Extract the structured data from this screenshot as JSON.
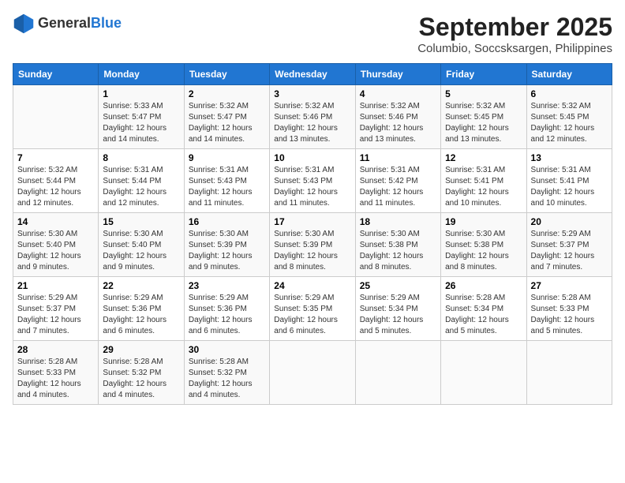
{
  "header": {
    "logo_general": "General",
    "logo_blue": "Blue",
    "month_year": "September 2025",
    "subtitle": "Columbio, Soccsksargen, Philippines"
  },
  "weekdays": [
    "Sunday",
    "Monday",
    "Tuesday",
    "Wednesday",
    "Thursday",
    "Friday",
    "Saturday"
  ],
  "weeks": [
    [
      {
        "day": "",
        "info": ""
      },
      {
        "day": "1",
        "info": "Sunrise: 5:33 AM\nSunset: 5:47 PM\nDaylight: 12 hours\nand 14 minutes."
      },
      {
        "day": "2",
        "info": "Sunrise: 5:32 AM\nSunset: 5:47 PM\nDaylight: 12 hours\nand 14 minutes."
      },
      {
        "day": "3",
        "info": "Sunrise: 5:32 AM\nSunset: 5:46 PM\nDaylight: 12 hours\nand 13 minutes."
      },
      {
        "day": "4",
        "info": "Sunrise: 5:32 AM\nSunset: 5:46 PM\nDaylight: 12 hours\nand 13 minutes."
      },
      {
        "day": "5",
        "info": "Sunrise: 5:32 AM\nSunset: 5:45 PM\nDaylight: 12 hours\nand 13 minutes."
      },
      {
        "day": "6",
        "info": "Sunrise: 5:32 AM\nSunset: 5:45 PM\nDaylight: 12 hours\nand 12 minutes."
      }
    ],
    [
      {
        "day": "7",
        "info": "Sunrise: 5:32 AM\nSunset: 5:44 PM\nDaylight: 12 hours\nand 12 minutes."
      },
      {
        "day": "8",
        "info": "Sunrise: 5:31 AM\nSunset: 5:44 PM\nDaylight: 12 hours\nand 12 minutes."
      },
      {
        "day": "9",
        "info": "Sunrise: 5:31 AM\nSunset: 5:43 PM\nDaylight: 12 hours\nand 11 minutes."
      },
      {
        "day": "10",
        "info": "Sunrise: 5:31 AM\nSunset: 5:43 PM\nDaylight: 12 hours\nand 11 minutes."
      },
      {
        "day": "11",
        "info": "Sunrise: 5:31 AM\nSunset: 5:42 PM\nDaylight: 12 hours\nand 11 minutes."
      },
      {
        "day": "12",
        "info": "Sunrise: 5:31 AM\nSunset: 5:41 PM\nDaylight: 12 hours\nand 10 minutes."
      },
      {
        "day": "13",
        "info": "Sunrise: 5:31 AM\nSunset: 5:41 PM\nDaylight: 12 hours\nand 10 minutes."
      }
    ],
    [
      {
        "day": "14",
        "info": "Sunrise: 5:30 AM\nSunset: 5:40 PM\nDaylight: 12 hours\nand 9 minutes."
      },
      {
        "day": "15",
        "info": "Sunrise: 5:30 AM\nSunset: 5:40 PM\nDaylight: 12 hours\nand 9 minutes."
      },
      {
        "day": "16",
        "info": "Sunrise: 5:30 AM\nSunset: 5:39 PM\nDaylight: 12 hours\nand 9 minutes."
      },
      {
        "day": "17",
        "info": "Sunrise: 5:30 AM\nSunset: 5:39 PM\nDaylight: 12 hours\nand 8 minutes."
      },
      {
        "day": "18",
        "info": "Sunrise: 5:30 AM\nSunset: 5:38 PM\nDaylight: 12 hours\nand 8 minutes."
      },
      {
        "day": "19",
        "info": "Sunrise: 5:30 AM\nSunset: 5:38 PM\nDaylight: 12 hours\nand 8 minutes."
      },
      {
        "day": "20",
        "info": "Sunrise: 5:29 AM\nSunset: 5:37 PM\nDaylight: 12 hours\nand 7 minutes."
      }
    ],
    [
      {
        "day": "21",
        "info": "Sunrise: 5:29 AM\nSunset: 5:37 PM\nDaylight: 12 hours\nand 7 minutes."
      },
      {
        "day": "22",
        "info": "Sunrise: 5:29 AM\nSunset: 5:36 PM\nDaylight: 12 hours\nand 6 minutes."
      },
      {
        "day": "23",
        "info": "Sunrise: 5:29 AM\nSunset: 5:36 PM\nDaylight: 12 hours\nand 6 minutes."
      },
      {
        "day": "24",
        "info": "Sunrise: 5:29 AM\nSunset: 5:35 PM\nDaylight: 12 hours\nand 6 minutes."
      },
      {
        "day": "25",
        "info": "Sunrise: 5:29 AM\nSunset: 5:34 PM\nDaylight: 12 hours\nand 5 minutes."
      },
      {
        "day": "26",
        "info": "Sunrise: 5:28 AM\nSunset: 5:34 PM\nDaylight: 12 hours\nand 5 minutes."
      },
      {
        "day": "27",
        "info": "Sunrise: 5:28 AM\nSunset: 5:33 PM\nDaylight: 12 hours\nand 5 minutes."
      }
    ],
    [
      {
        "day": "28",
        "info": "Sunrise: 5:28 AM\nSunset: 5:33 PM\nDaylight: 12 hours\nand 4 minutes."
      },
      {
        "day": "29",
        "info": "Sunrise: 5:28 AM\nSunset: 5:32 PM\nDaylight: 12 hours\nand 4 minutes."
      },
      {
        "day": "30",
        "info": "Sunrise: 5:28 AM\nSunset: 5:32 PM\nDaylight: 12 hours\nand 4 minutes."
      },
      {
        "day": "",
        "info": ""
      },
      {
        "day": "",
        "info": ""
      },
      {
        "day": "",
        "info": ""
      },
      {
        "day": "",
        "info": ""
      }
    ]
  ]
}
